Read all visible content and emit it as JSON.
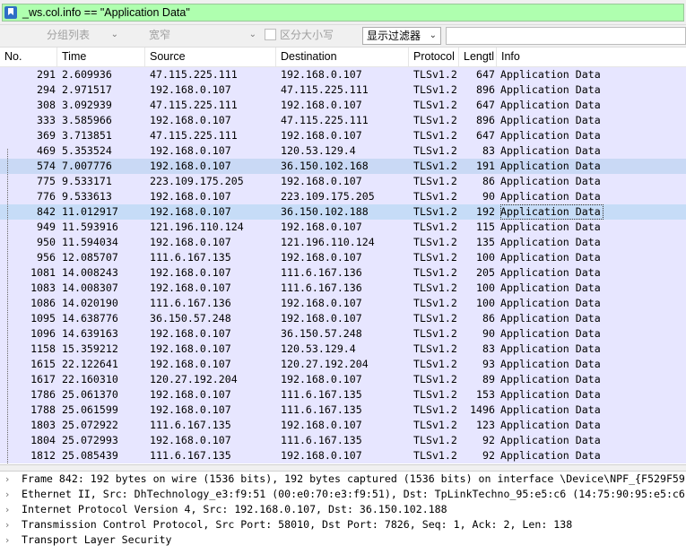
{
  "filter": {
    "icon": "bookmark-icon",
    "text": "_ws.col.info == \"Application Data\""
  },
  "toolbar": {
    "group_list": "分组列表",
    "encoding": "宽窄",
    "case_sensitive": "区分大小写",
    "display_filter": "显示过滤器",
    "search_value": ""
  },
  "columns": [
    "No.",
    "Time",
    "Source",
    "Destination",
    "Protocol",
    "Lengtl",
    "Info"
  ],
  "packets": [
    {
      "no": "291",
      "time": "2.609936",
      "src": "47.115.225.111",
      "dst": "192.168.0.107",
      "proto": "TLSv1.2",
      "len": "647",
      "info": "Application Data"
    },
    {
      "no": "294",
      "time": "2.971517",
      "src": "192.168.0.107",
      "dst": "47.115.225.111",
      "proto": "TLSv1.2",
      "len": "896",
      "info": "Application Data"
    },
    {
      "no": "308",
      "time": "3.092939",
      "src": "47.115.225.111",
      "dst": "192.168.0.107",
      "proto": "TLSv1.2",
      "len": "647",
      "info": "Application Data"
    },
    {
      "no": "333",
      "time": "3.585966",
      "src": "192.168.0.107",
      "dst": "47.115.225.111",
      "proto": "TLSv1.2",
      "len": "896",
      "info": "Application Data"
    },
    {
      "no": "369",
      "time": "3.713851",
      "src": "47.115.225.111",
      "dst": "192.168.0.107",
      "proto": "TLSv1.2",
      "len": "647",
      "info": "Application Data"
    },
    {
      "no": "469",
      "time": "5.353524",
      "src": "192.168.0.107",
      "dst": "120.53.129.4",
      "proto": "TLSv1.2",
      "len": "83",
      "info": "Application Data"
    },
    {
      "no": "574",
      "time": "7.007776",
      "src": "192.168.0.107",
      "dst": "36.150.102.168",
      "proto": "TLSv1.2",
      "len": "191",
      "info": "Application Data"
    },
    {
      "no": "775",
      "time": "9.533171",
      "src": "223.109.175.205",
      "dst": "192.168.0.107",
      "proto": "TLSv1.2",
      "len": "86",
      "info": "Application Data"
    },
    {
      "no": "776",
      "time": "9.533613",
      "src": "192.168.0.107",
      "dst": "223.109.175.205",
      "proto": "TLSv1.2",
      "len": "90",
      "info": "Application Data"
    },
    {
      "no": "842",
      "time": "11.012917",
      "src": "192.168.0.107",
      "dst": "36.150.102.188",
      "proto": "TLSv1.2",
      "len": "192",
      "info": "Application Data"
    },
    {
      "no": "949",
      "time": "11.593916",
      "src": "121.196.110.124",
      "dst": "192.168.0.107",
      "proto": "TLSv1.2",
      "len": "115",
      "info": "Application Data"
    },
    {
      "no": "950",
      "time": "11.594034",
      "src": "192.168.0.107",
      "dst": "121.196.110.124",
      "proto": "TLSv1.2",
      "len": "135",
      "info": "Application Data"
    },
    {
      "no": "956",
      "time": "12.085707",
      "src": "111.6.167.135",
      "dst": "192.168.0.107",
      "proto": "TLSv1.2",
      "len": "100",
      "info": "Application Data"
    },
    {
      "no": "1081",
      "time": "14.008243",
      "src": "192.168.0.107",
      "dst": "111.6.167.136",
      "proto": "TLSv1.2",
      "len": "205",
      "info": "Application Data"
    },
    {
      "no": "1083",
      "time": "14.008307",
      "src": "192.168.0.107",
      "dst": "111.6.167.136",
      "proto": "TLSv1.2",
      "len": "100",
      "info": "Application Data"
    },
    {
      "no": "1086",
      "time": "14.020190",
      "src": "111.6.167.136",
      "dst": "192.168.0.107",
      "proto": "TLSv1.2",
      "len": "100",
      "info": "Application Data"
    },
    {
      "no": "1095",
      "time": "14.638776",
      "src": "36.150.57.248",
      "dst": "192.168.0.107",
      "proto": "TLSv1.2",
      "len": "86",
      "info": "Application Data"
    },
    {
      "no": "1096",
      "time": "14.639163",
      "src": "192.168.0.107",
      "dst": "36.150.57.248",
      "proto": "TLSv1.2",
      "len": "90",
      "info": "Application Data"
    },
    {
      "no": "1158",
      "time": "15.359212",
      "src": "192.168.0.107",
      "dst": "120.53.129.4",
      "proto": "TLSv1.2",
      "len": "83",
      "info": "Application Data"
    },
    {
      "no": "1615",
      "time": "22.122641",
      "src": "192.168.0.107",
      "dst": "120.27.192.204",
      "proto": "TLSv1.2",
      "len": "93",
      "info": "Application Data"
    },
    {
      "no": "1617",
      "time": "22.160310",
      "src": "120.27.192.204",
      "dst": "192.168.0.107",
      "proto": "TLSv1.2",
      "len": "89",
      "info": "Application Data"
    },
    {
      "no": "1786",
      "time": "25.061370",
      "src": "192.168.0.107",
      "dst": "111.6.167.135",
      "proto": "TLSv1.2",
      "len": "153",
      "info": "Application Data"
    },
    {
      "no": "1788",
      "time": "25.061599",
      "src": "192.168.0.107",
      "dst": "111.6.167.135",
      "proto": "TLSv1.2",
      "len": "1496",
      "info": "Application Data"
    },
    {
      "no": "1803",
      "time": "25.072922",
      "src": "111.6.167.135",
      "dst": "192.168.0.107",
      "proto": "TLSv1.2",
      "len": "123",
      "info": "Application Data"
    },
    {
      "no": "1804",
      "time": "25.072993",
      "src": "192.168.0.107",
      "dst": "111.6.167.135",
      "proto": "TLSv1.2",
      "len": "92",
      "info": "Application Data"
    },
    {
      "no": "1812",
      "time": "25.085439",
      "src": "111.6.167.135",
      "dst": "192.168.0.107",
      "proto": "TLSv1.2",
      "len": "92",
      "info": "Application Data"
    }
  ],
  "selected_no": "842",
  "highlighted_no": "574",
  "colors": {
    "filter_ok": "#afffaf",
    "row_tls": "#e7e6ff",
    "row_selected": "#c6dcf7"
  },
  "details": [
    "Frame 842: 192 bytes on wire (1536 bits), 192 bytes captured (1536 bits) on interface \\Device\\NPF_{F529F59",
    "Ethernet II, Src: DhTechnology_e3:f9:51 (00:e0:70:e3:f9:51), Dst: TpLinkTechno_95:e5:c6 (14:75:90:95:e5:c6",
    "Internet Protocol Version 4, Src: 192.168.0.107, Dst: 36.150.102.188",
    "Transmission Control Protocol, Src Port: 58010, Dst Port: 7826, Seq: 1, Ack: 2, Len: 138",
    "Transport Layer Security"
  ]
}
